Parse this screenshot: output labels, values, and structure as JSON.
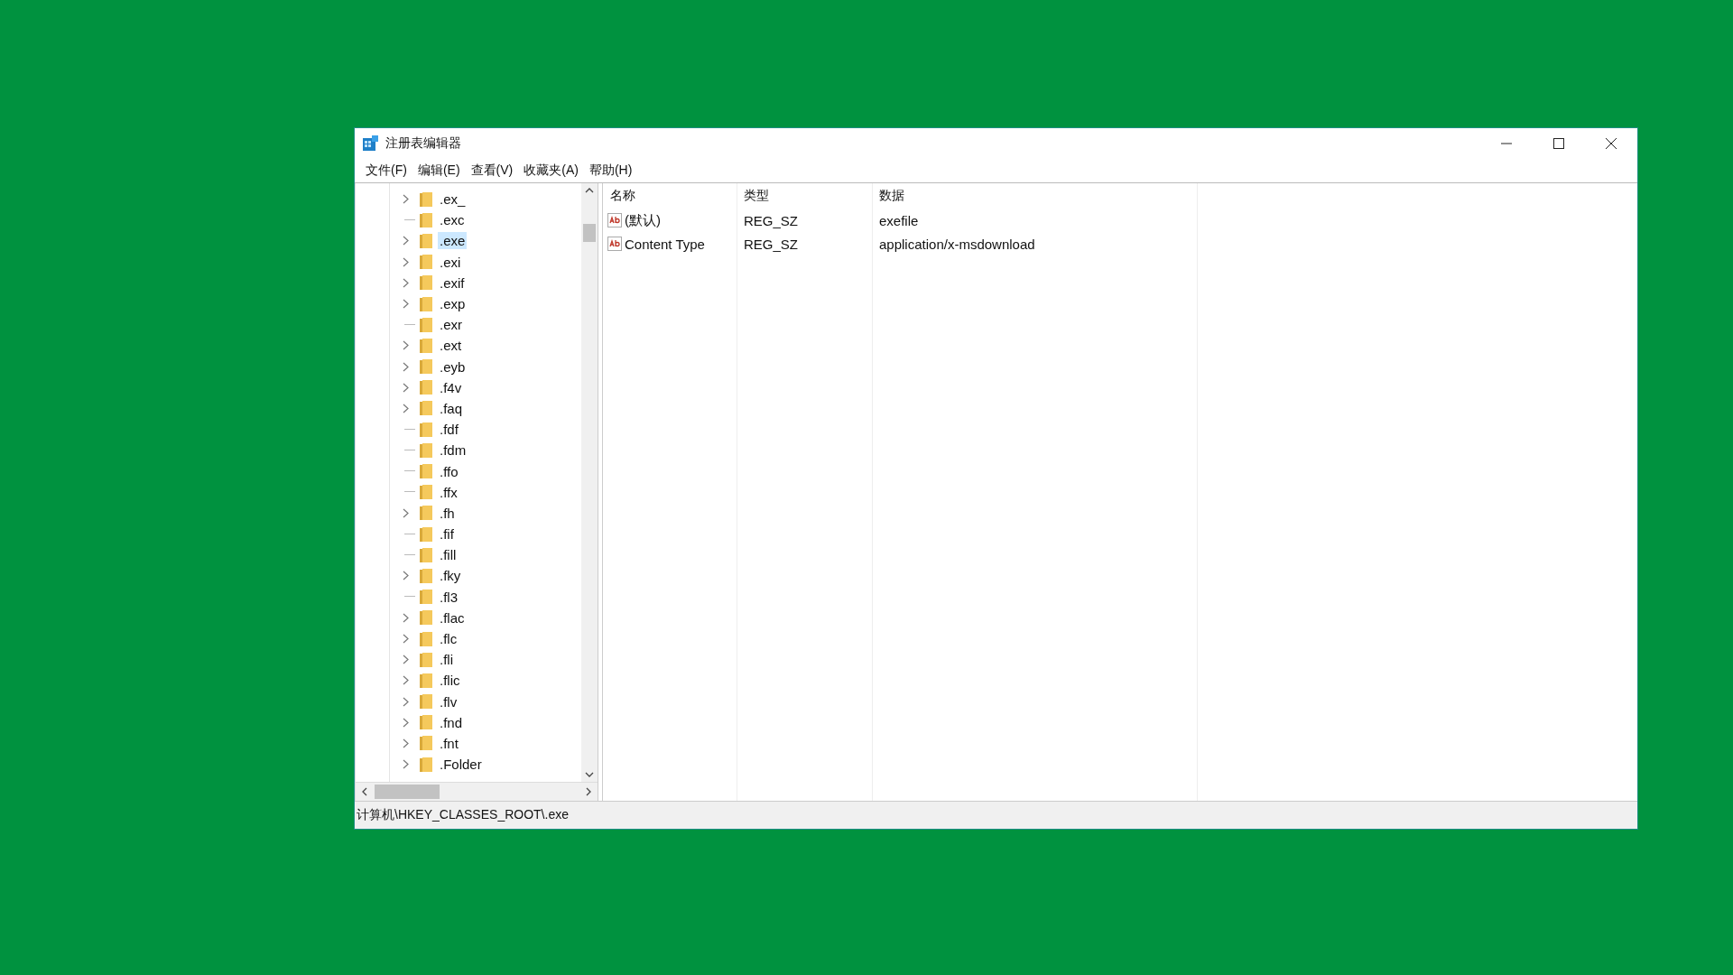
{
  "window": {
    "title": "注册表编辑器"
  },
  "menu": [
    "文件(F)",
    "编辑(E)",
    "查看(V)",
    "收藏夹(A)",
    "帮助(H)"
  ],
  "tree": {
    "items": [
      {
        "label": ".ex_",
        "expandable": true,
        "selected": false
      },
      {
        "label": ".exc",
        "expandable": false,
        "selected": false
      },
      {
        "label": ".exe",
        "expandable": true,
        "selected": true
      },
      {
        "label": ".exi",
        "expandable": true,
        "selected": false
      },
      {
        "label": ".exif",
        "expandable": true,
        "selected": false
      },
      {
        "label": ".exp",
        "expandable": true,
        "selected": false
      },
      {
        "label": ".exr",
        "expandable": false,
        "selected": false
      },
      {
        "label": ".ext",
        "expandable": true,
        "selected": false
      },
      {
        "label": ".eyb",
        "expandable": true,
        "selected": false
      },
      {
        "label": ".f4v",
        "expandable": true,
        "selected": false
      },
      {
        "label": ".faq",
        "expandable": true,
        "selected": false
      },
      {
        "label": ".fdf",
        "expandable": false,
        "selected": false
      },
      {
        "label": ".fdm",
        "expandable": false,
        "selected": false
      },
      {
        "label": ".ffo",
        "expandable": false,
        "selected": false
      },
      {
        "label": ".ffx",
        "expandable": false,
        "selected": false
      },
      {
        "label": ".fh",
        "expandable": true,
        "selected": false
      },
      {
        "label": ".fif",
        "expandable": false,
        "selected": false
      },
      {
        "label": ".fill",
        "expandable": false,
        "selected": false
      },
      {
        "label": ".fky",
        "expandable": true,
        "selected": false
      },
      {
        "label": ".fl3",
        "expandable": false,
        "selected": false
      },
      {
        "label": ".flac",
        "expandable": true,
        "selected": false
      },
      {
        "label": ".flc",
        "expandable": true,
        "selected": false
      },
      {
        "label": ".fli",
        "expandable": true,
        "selected": false
      },
      {
        "label": ".flic",
        "expandable": true,
        "selected": false
      },
      {
        "label": ".flv",
        "expandable": true,
        "selected": false
      },
      {
        "label": ".fnd",
        "expandable": true,
        "selected": false
      },
      {
        "label": ".fnt",
        "expandable": true,
        "selected": false
      },
      {
        "label": ".Folder",
        "expandable": true,
        "selected": false
      }
    ]
  },
  "values": {
    "columns": [
      "名称",
      "类型",
      "数据"
    ],
    "rows": [
      {
        "name": "(默认)",
        "type": "REG_SZ",
        "data": "exefile"
      },
      {
        "name": "Content Type",
        "type": "REG_SZ",
        "data": "application/x-msdownload"
      }
    ]
  },
  "status_bar": "计算机\\HKEY_CLASSES_ROOT\\.exe"
}
